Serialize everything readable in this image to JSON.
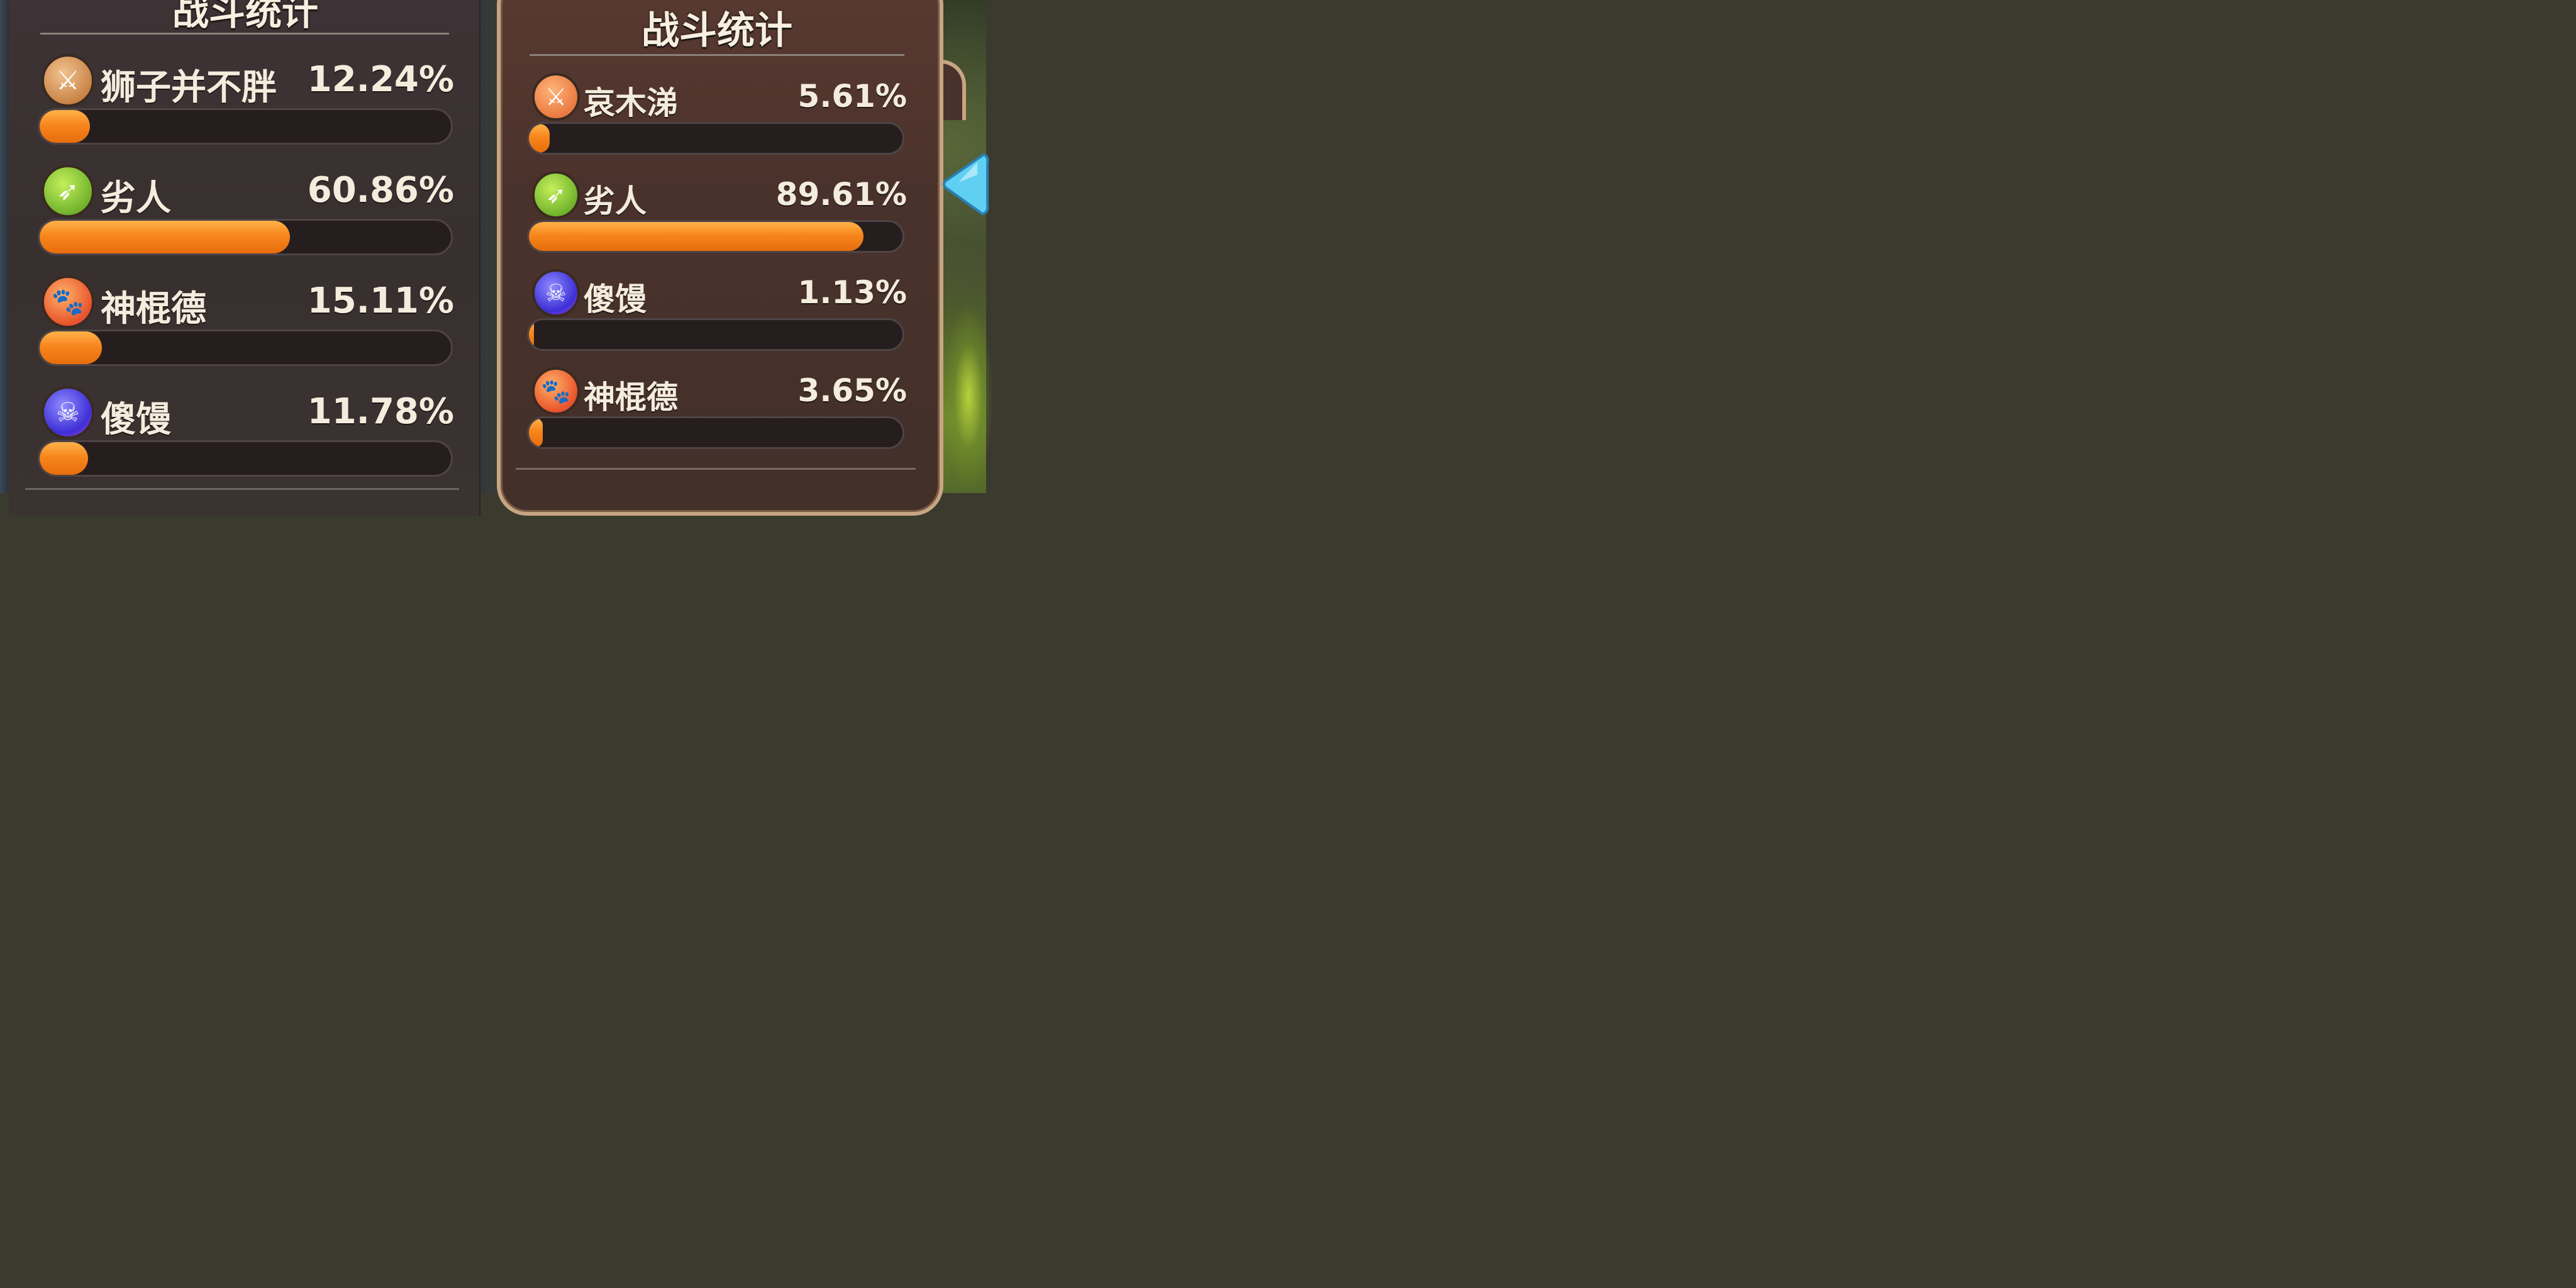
{
  "left_panel": {
    "title": "战斗统计",
    "stats": [
      {
        "name": "狮子并不胖",
        "value": "12.24%",
        "fill": 0.1224,
        "icon": "crossed-swords-icon",
        "icon_style": "warrior"
      },
      {
        "name": "劣人",
        "value": "60.86%",
        "fill": 0.6086,
        "icon": "bow-arrow-icon",
        "icon_style": "archer"
      },
      {
        "name": "神棍德",
        "value": "15.11%",
        "fill": 0.1511,
        "icon": "paw-icon",
        "icon_style": "beast"
      },
      {
        "name": "傻馒",
        "value": "11.78%",
        "fill": 0.1178,
        "icon": "skull-icon",
        "icon_style": "ghost"
      }
    ]
  },
  "right_panel": {
    "title": "战斗统计",
    "stats": [
      {
        "name": "哀木涕",
        "value": "5.61%",
        "fill": 0.0561,
        "icon": "crossed-swords-icon",
        "icon_style": "warrior-orange"
      },
      {
        "name": "劣人",
        "value": "89.61%",
        "fill": 0.8961,
        "icon": "bow-arrow-icon",
        "icon_style": "archer"
      },
      {
        "name": "傻馒",
        "value": "1.13%",
        "fill": 0.0113,
        "icon": "skull-icon",
        "icon_style": "ghost"
      },
      {
        "name": "神棍德",
        "value": "3.65%",
        "fill": 0.0365,
        "icon": "paw-icon",
        "icon_style": "beast"
      }
    ]
  },
  "colors": {
    "bar_fill": "#f7861c",
    "text": "#f4ecdc",
    "panel_border": "#c7a583"
  }
}
